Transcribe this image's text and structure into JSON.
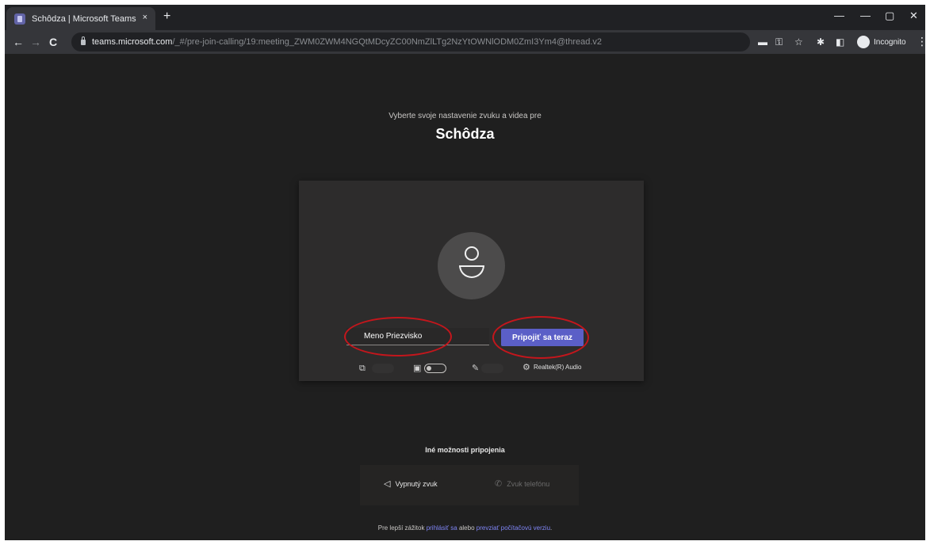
{
  "browser": {
    "tab_title": "Schôdza | Microsoft Teams",
    "tab_close": "×",
    "new_tab": "+",
    "window_controls": [
      "—",
      "—",
      "▢",
      "✕"
    ],
    "nav": {
      "back": "←",
      "forward": "→",
      "reload": "C"
    },
    "url_domain": "teams.microsoft.com",
    "url_path": "/_#/pre-join-calling/19:meeting_ZWM0ZWM4NGQtMDcyZC00NmZlLTg2NzYtOWNlODM0ZmI3Ym4@thread.v2",
    "toolbar_icons": [
      "▬",
      "⚿",
      "☆",
      "✱",
      "◧"
    ],
    "profile_label": "Incognito",
    "menu": "⋮"
  },
  "prejoin": {
    "subtitle": "Vyberte svoje nastavenie zvuku a videa pre",
    "meeting_title": "Schôdza",
    "name_value": "Meno Priezvisko",
    "join_label": "Pripojiť sa teraz",
    "audio_device": "Realtek(R) Audio",
    "other_options_label": "Iné možnosti pripojenia",
    "audio_off_label": "Vypnutý zvuk",
    "phone_audio_label": "Zvuk telefónu",
    "footer_prefix": "Pre lepší zážitok",
    "footer_link1": "prihlásiť sa",
    "footer_mid": "alebo",
    "footer_link2": "prevziať počítačovú verziu",
    "footer_suffix": "."
  },
  "colors": {
    "accent": "#5b5fc7",
    "highlight_ring": "#c4161c",
    "background": "#1f1f1f",
    "card": "#2d2c2c"
  },
  "icons": {
    "camera": "camera-off-icon",
    "mic": "mic-icon",
    "blur": "background-blur-icon",
    "settings": "gear-icon",
    "speaker_off": "speaker-off-icon",
    "phone": "phone-icon"
  }
}
